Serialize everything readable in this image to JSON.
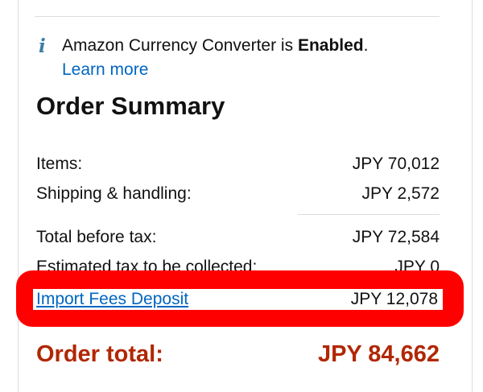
{
  "currency_notice": {
    "icon": "info-icon",
    "icon_glyph": "i",
    "text_prefix": "Amazon Currency Converter is ",
    "status": "Enabled",
    "text_suffix": ".",
    "learn_more": "Learn more"
  },
  "order_summary": {
    "title": "Order Summary",
    "items_label": "Items:",
    "items_value": "JPY 70,012",
    "shipping_label": "Shipping & handling:",
    "shipping_value": "JPY 2,572",
    "before_tax_label": "Total before tax:",
    "before_tax_value": "JPY 72,584",
    "tax_label": "Estimated tax to be collected:",
    "tax_value": "JPY 0",
    "import_fees_label": "Import Fees Deposit",
    "import_fees_value": "JPY 12,078",
    "total_label": "Order total:",
    "total_value": "JPY 84,662"
  },
  "colors": {
    "link": "#0066c0",
    "total": "#b12704",
    "highlight": "#ff0000",
    "info_icon": "#3d7ea6"
  }
}
